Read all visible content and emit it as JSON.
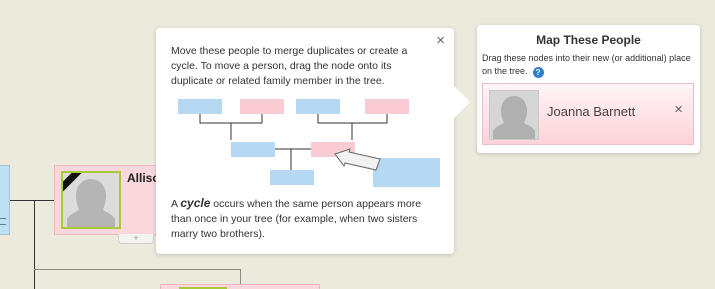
{
  "tree": {
    "person_name": "Allison",
    "expand_glyph": "+"
  },
  "popover": {
    "close_glyph": "×",
    "intro_text": "Move these people to merge duplicates or create a cycle. To move a person, drag the node onto its duplicate or related family member in the tree.",
    "cycle_word": "cycle",
    "cycle_prefix": "A ",
    "cycle_rest": " occurs when the same person appears more than once in your tree (for example, when two sisters marry two brothers).",
    "diagram_colors": {
      "male": "#b5d9f2",
      "female": "#f9ccd3",
      "line": "#333333"
    }
  },
  "map_panel": {
    "title": "Map These People",
    "description": "Drag these nodes into their new (or additional) place on the tree.",
    "help_glyph": "?",
    "person": {
      "name": "Joanna Barnett",
      "remove_glyph": "×"
    }
  },
  "colors": {
    "background": "#ebeadd",
    "female_node": "#f9d7dd",
    "male_node": "#bfe0ef",
    "accent_green": "#a9c93a",
    "help_blue": "#2f7fd1"
  }
}
